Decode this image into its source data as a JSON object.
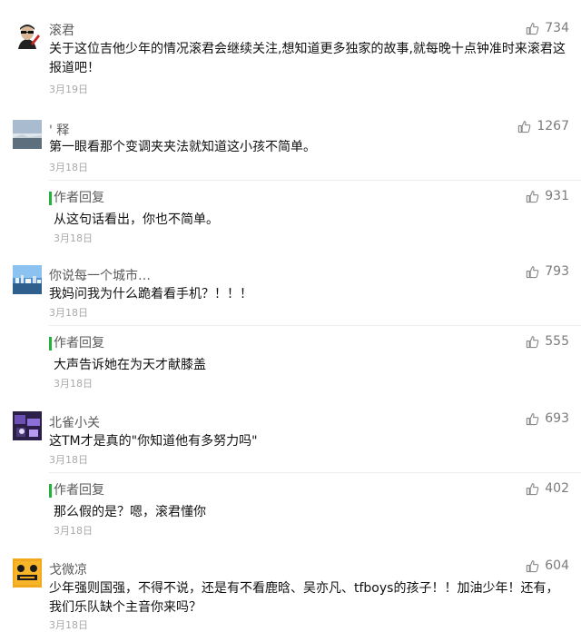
{
  "comments": [
    {
      "name": "滚君",
      "likes": "734",
      "text": "关于这位吉他少年的情况滚君会继续关注,想知道更多独家的故事,就每晚十点钟准时来滚君这报道吧！",
      "date": "3月19日"
    },
    {
      "name": "' 释",
      "likes": "1267",
      "text": "第一眼看那个变调夹夹法就知道这小孩不简单。",
      "date": "3月18日",
      "reply": {
        "label": "作者回复",
        "likes": "931",
        "text": "从这句话看出，你也不简单。",
        "date": "3月18日"
      }
    },
    {
      "name": "你说每一个城市…",
      "likes": "793",
      "text": "我妈问我为什么跪着看手机？！！！",
      "date": "3月18日",
      "reply": {
        "label": "作者回复",
        "likes": "555",
        "text": "大声告诉她在为天才献膝盖",
        "date": "3月18日"
      }
    },
    {
      "name": "北雀小关",
      "likes": "693",
      "text": "这TM才是真的\"你知道他有多努力吗\"",
      "date": "3月18日",
      "reply": {
        "label": "作者回复",
        "likes": "402",
        "text": "那么假的是？嗯，滚君懂你",
        "date": "3月18日"
      }
    },
    {
      "name": "戈微凉",
      "likes": "604",
      "text": "少年强则国强，不得不说，还是有不看鹿晗、吴亦凡、tfboys的孩子！！加油少年！还有，我们乐队缺个主音你来吗？",
      "date": "3月18日"
    }
  ],
  "icons": {
    "like": "thumbs-up-icon"
  },
  "colors": {
    "reply_accent": "#21b33b",
    "meta_text": "#a9a9a9",
    "like_icon": "#8a8a8a"
  }
}
